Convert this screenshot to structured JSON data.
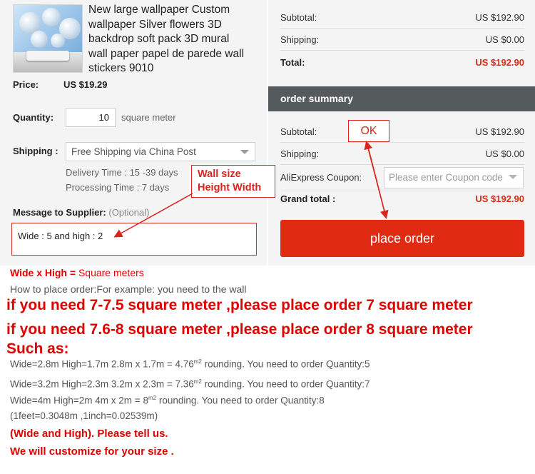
{
  "product": {
    "title_lines": [
      "New large wallpaper Custom",
      "wallpaper Silver flowers 3D",
      "backdrop soft pack 3D mural",
      "wall paper papel de parede wall",
      "stickers 9010"
    ],
    "price_label": "Price:",
    "price_value": "US $19.29",
    "quantity_label": "Quantity:",
    "quantity_value": "10",
    "quantity_unit": "square meter",
    "shipping_label": "Shipping :",
    "shipping_selected": "Free Shipping via China Post",
    "delivery_time": "Delivery Time : 15 -39 days",
    "processing_time": "Processing Time : 7 days",
    "message_label": "Message to Supplier:",
    "message_optional": "(Optional)",
    "message_value": "Wide : 5 and high : 2"
  },
  "totals_top": {
    "subtotal_label": "Subtotal:",
    "subtotal_value": "US $192.90",
    "shipping_label": "Shipping:",
    "shipping_value": "US $0.00",
    "total_label": "Total:",
    "total_value": "US $192.90"
  },
  "order_summary": {
    "heading": "order summary",
    "subtotal_label": "Subtotal:",
    "subtotal_value": "US $192.90",
    "shipping_label": "Shipping:",
    "shipping_value": "US $0.00",
    "coupon_label": "AliExpress Coupon:",
    "coupon_placeholder": "Please enter Coupon code",
    "grand_total_label": "Grand total :",
    "grand_total_value": "US $192.90",
    "place_order_label": "place order"
  },
  "annotations": {
    "wall_size_line1": "Wall size",
    "wall_size_line2": "Height Width",
    "ok": "OK"
  },
  "instructions": {
    "formula_bold": "Wide x High =",
    "formula_rest": " Square meters",
    "how_to": "How to place order:For example: you need to the wall",
    "rule1": "if you need 7-7.5 square meter ,please place order 7 square meter",
    "rule2": "if you need 7.6-8 square meter ,please place order 8 square meter",
    "such_as": "Such as:",
    "ex1_a": "Wide=2.8m   High=1.7m   2.8m x 1.7m = 4.76",
    "ex1_b": " rounding. You need to order Quantity:5",
    "ex2_a": "Wide=3.2m   High=2.3m   3.2m x 2.3m = 7.36",
    "ex2_b": " rounding. You need to order Quantity:7",
    "ex3_a": "Wide=4m      High=2m      4m x 2m = 8",
    "ex3_b": " rounding. You need to order Quantity:8",
    "sup": "m2",
    "conversion": "(1feet=0.3048m ,1inch=0.02539m)",
    "tell_us": "(Wide and High). Please tell us.",
    "customize": "We will customize for your size ."
  },
  "colors": {
    "accent_red": "#e02b12",
    "annotation_red": "#d9251d",
    "summary_bar": "#555a5d"
  }
}
